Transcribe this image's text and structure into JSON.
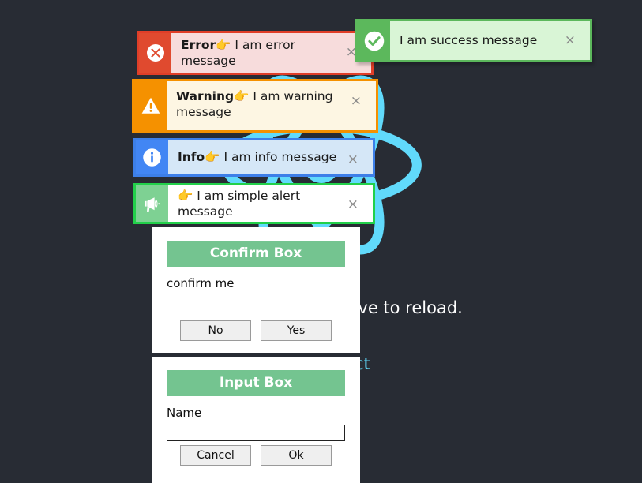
{
  "background": {
    "logo_icon": "react-logo-icon",
    "edit_text": "Edit src/App.js and save to reload.",
    "learn_link": "Learn React",
    "bg_color": "#282c34",
    "link_color": "#61dafb"
  },
  "alerts": [
    {
      "id": "error",
      "icon": "error-circle-x-icon",
      "title": "Error",
      "emoji": "👉",
      "message": " I am error message",
      "close_label": "×",
      "border_color": "#e03e28",
      "body_color": "#f7dcdc",
      "icon_bg": "#e04a2f"
    },
    {
      "id": "success",
      "icon": "success-check-circle-icon",
      "title": "",
      "emoji": "",
      "message": "I am success message",
      "close_label": "×",
      "border_color": "#5cb85c",
      "body_color": "#d9f5d6",
      "icon_bg": "#5cb85c"
    },
    {
      "id": "warning",
      "icon": "warning-triangle-icon",
      "title": "Warning",
      "emoji": "👉",
      "message": " I am warning message",
      "close_label": "×",
      "border_color": "#f59100",
      "body_color": "#fdf6e3",
      "icon_bg": "#f59100"
    },
    {
      "id": "info",
      "icon": "info-circle-icon",
      "title": "Info",
      "emoji": "👉",
      "message": " I am info message",
      "close_label": "×",
      "border_color": "#3d7fe8",
      "body_color": "#d5e7f7",
      "icon_bg": "#4286f4"
    },
    {
      "id": "simple",
      "icon": "megaphone-icon",
      "title": "",
      "emoji": "👉",
      "message": " I am simple alert message",
      "close_label": "×",
      "border_color": "#22d04a",
      "body_color": "#ffffff",
      "icon_bg": "#7ed193"
    }
  ],
  "confirm_dialog": {
    "title": "Confirm Box",
    "text": "confirm me",
    "no_label": "No",
    "yes_label": "Yes",
    "title_bg": "#74c490"
  },
  "input_dialog": {
    "title": "Input Box",
    "field_label": "Name",
    "field_value": "",
    "field_placeholder": "",
    "cancel_label": "Cancel",
    "ok_label": "Ok",
    "title_bg": "#74c490"
  }
}
